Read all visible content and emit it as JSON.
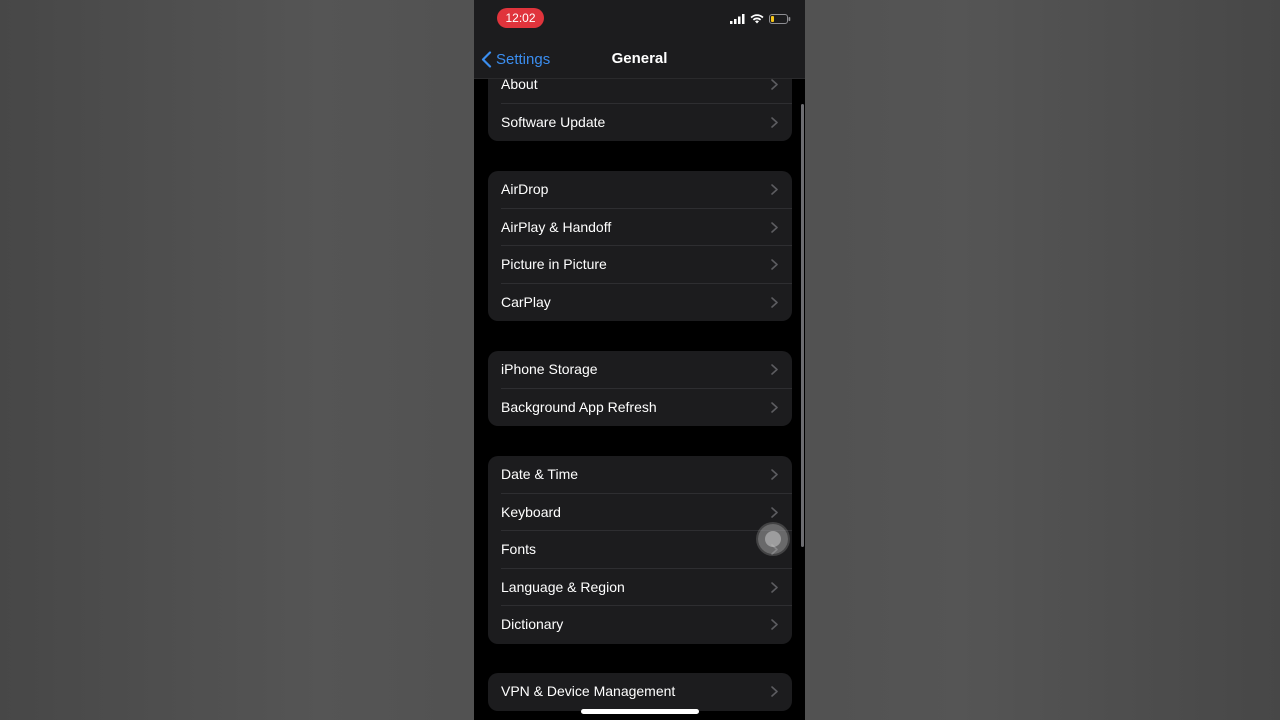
{
  "status_bar": {
    "time": "12:02",
    "signal_icon": "cellular-signal-icon",
    "wifi_icon": "wifi-icon",
    "battery_icon": "battery-low-icon",
    "accent_color": "#e0343c"
  },
  "nav": {
    "back_label": "Settings",
    "title": "General",
    "accent_color": "#3b8ef0"
  },
  "groups": [
    {
      "items": [
        {
          "label": "About"
        },
        {
          "label": "Software Update"
        }
      ]
    },
    {
      "items": [
        {
          "label": "AirDrop"
        },
        {
          "label": "AirPlay & Handoff"
        },
        {
          "label": "Picture in Picture"
        },
        {
          "label": "CarPlay"
        }
      ]
    },
    {
      "items": [
        {
          "label": "iPhone Storage"
        },
        {
          "label": "Background App Refresh"
        }
      ]
    },
    {
      "items": [
        {
          "label": "Date & Time"
        },
        {
          "label": "Keyboard"
        },
        {
          "label": "Fonts"
        },
        {
          "label": "Language & Region"
        },
        {
          "label": "Dictionary"
        }
      ]
    },
    {
      "items": [
        {
          "label": "VPN & Device Management"
        }
      ]
    }
  ]
}
